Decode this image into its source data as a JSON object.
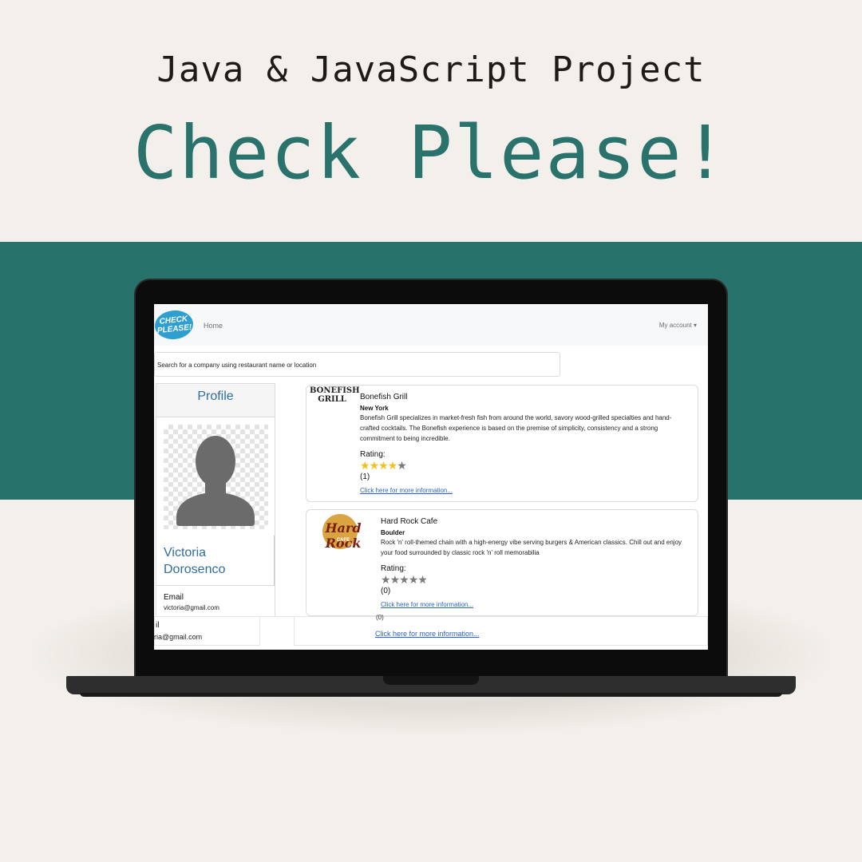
{
  "banner": {
    "subtitle": "Java & JavaScript Project",
    "title": "Check Please!",
    "teal": "#28726c"
  },
  "navbar": {
    "logo_text": "CHECK PLEASE!",
    "home": "Home",
    "account": "My account ▾"
  },
  "search": {
    "placeholder": "Search for a company using restaurant name or location"
  },
  "profile": {
    "header": "Profile",
    "avatar_icon": "user-silhouette-icon",
    "name": "Victoria Dorosenco",
    "email_label": "Email",
    "email": "victoria@gmail.com"
  },
  "restaurants": [
    {
      "logo_text": "BONEFISH GRILL",
      "name": "Bonefish Grill",
      "city": "New York",
      "description": "Bonefish Grill specializes in market-fresh fish from around the world, savory wood-grilled specialties and hand-crafted cocktails. The Bonefish experience is based on the premise of simplicity, consistency and a strong commitment to being incredible.",
      "rating_label": "Rating:",
      "rating": 4,
      "rating_max": 5,
      "count": "(1)",
      "link": "Click here for more information..."
    },
    {
      "logo_text": "Hard Rock",
      "logo_subtext": "CAFE",
      "name": "Hard Rock Cafe",
      "city": "Boulder",
      "description": "Rock 'n' roll-themed chain with a high-energy vibe serving burgers & American classics. Chill out and enjoy your food surrounded by classic rock 'n' roll memorabilia",
      "rating_label": "Rating:",
      "rating": 0,
      "rating_max": 5,
      "count": "(0)",
      "link": "Click here for more information..."
    }
  ],
  "ghost": {
    "il": "il",
    "email": "ria@gmail.com",
    "zero": "(0)",
    "link": "Click here for more information..."
  }
}
